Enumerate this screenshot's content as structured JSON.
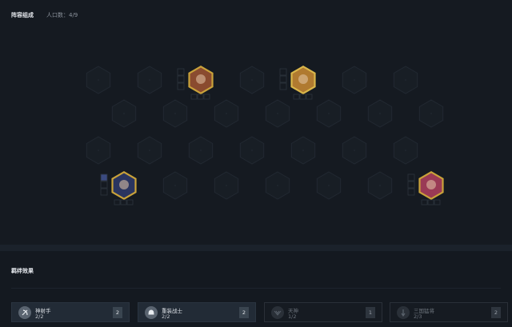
{
  "header": {
    "title": "阵容组成",
    "population": "人口数：4/9"
  },
  "board": {
    "rows": 4,
    "cols": 7,
    "units": [
      {
        "name": "champion-unit-1",
        "row": 0,
        "col": 2,
        "frame_color": "#c9a23a",
        "portrait": "#8a4b2f",
        "items": 0
      },
      {
        "name": "champion-unit-2",
        "row": 0,
        "col": 4,
        "frame_color": "#d9b64a",
        "portrait": "#b07a30",
        "items": 0
      },
      {
        "name": "champion-unit-3",
        "row": 3,
        "col": 0,
        "frame_color": "#c9a23a",
        "portrait": "#2a3560",
        "items": 1
      },
      {
        "name": "champion-unit-4",
        "row": 3,
        "col": 6,
        "frame_color": "#c9a23a",
        "portrait": "#9a3a55",
        "items": 0
      }
    ]
  },
  "bonds": {
    "title": "羁绊效果",
    "traits": [
      {
        "name": "神射手",
        "count": "2/2",
        "level": "2",
        "active": true,
        "icon": "bow-icon"
      },
      {
        "name": "重装战士",
        "count": "2/2",
        "level": "2",
        "active": true,
        "icon": "helmet-icon"
      },
      {
        "name": "天神",
        "count": "1/2",
        "level": "1",
        "active": false,
        "icon": "divine-icon"
      },
      {
        "name": "三国猛将",
        "count": "2/3",
        "level": "2",
        "active": false,
        "icon": "warlord-icon"
      }
    ]
  }
}
